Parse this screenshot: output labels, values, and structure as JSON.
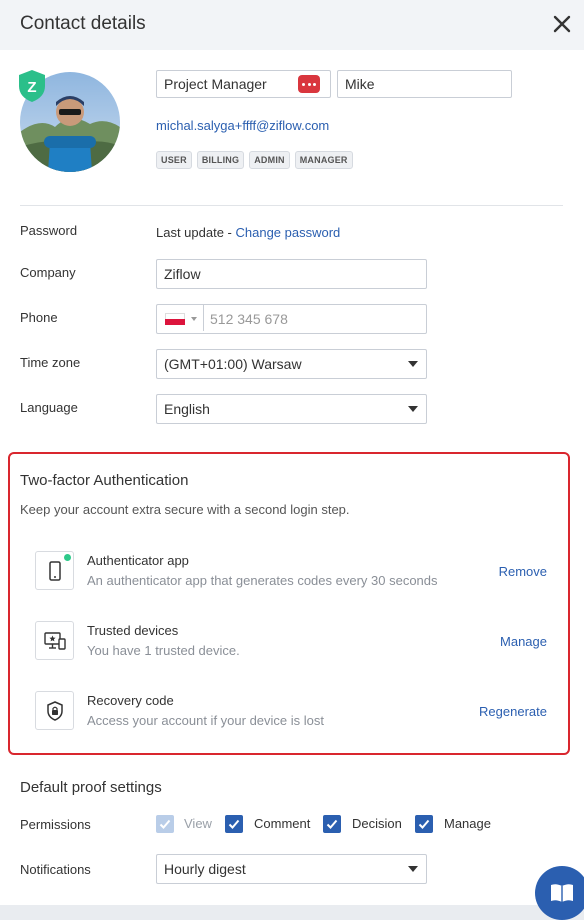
{
  "header": {
    "title": "Contact details"
  },
  "profile": {
    "position": "Project Manager",
    "first_name": "Mike",
    "email": "michal.salyga+ffff@ziflow.com",
    "badge_letter": "Z",
    "roles": [
      "USER",
      "BILLING",
      "ADMIN",
      "MANAGER"
    ]
  },
  "fields": {
    "password_label": "Password",
    "password_text": "Last update - ",
    "change_password": "Change password",
    "company_label": "Company",
    "company_value": "Ziflow",
    "phone_label": "Phone",
    "phone_placeholder": "512 345 678",
    "timezone_label": "Time zone",
    "timezone_value": "(GMT+01:00) Warsaw",
    "language_label": "Language",
    "language_value": "English"
  },
  "tfa": {
    "title": "Two-factor Authentication",
    "subtitle": "Keep your account extra secure with a second login step.",
    "items": [
      {
        "name": "Authenticator app",
        "desc": "An authenticator app that generates codes every 30 seconds",
        "action": "Remove",
        "icon": "phone-icon"
      },
      {
        "name": "Trusted devices",
        "desc": "You have 1 trusted device.",
        "action": "Manage",
        "icon": "devices-icon"
      },
      {
        "name": "Recovery code",
        "desc": "Access your account if your device is lost",
        "action": "Regenerate",
        "icon": "shield-lock-icon"
      }
    ]
  },
  "proof": {
    "title": "Default proof settings",
    "permissions_label": "Permissions",
    "permissions": [
      {
        "label": "View",
        "checked": true,
        "disabled": true
      },
      {
        "label": "Comment",
        "checked": true,
        "disabled": false
      },
      {
        "label": "Decision",
        "checked": true,
        "disabled": false
      },
      {
        "label": "Manage",
        "checked": true,
        "disabled": false
      }
    ],
    "notifications_label": "Notifications",
    "notifications_value": "Hourly digest"
  },
  "colors": {
    "accent": "#2b5fb0",
    "highlight_border": "#d9262e",
    "status_green": "#2ec98a"
  }
}
